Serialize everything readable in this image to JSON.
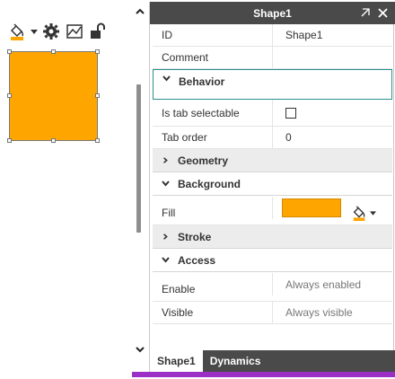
{
  "toolbar": {
    "icons": [
      "fill-bucket-icon",
      "gear-icon",
      "chart-icon",
      "unlock-icon"
    ],
    "colors": {
      "bucket_accent": "#ffa500"
    }
  },
  "shape": {
    "fill": "#ffa500"
  },
  "panel": {
    "title": "Shape1",
    "rows_top": [
      {
        "label": "ID",
        "value": "Shape1"
      },
      {
        "label": "Comment",
        "value": ""
      }
    ],
    "sections": {
      "behavior": "Behavior",
      "geometry": "Geometry",
      "background": "Background",
      "stroke": "Stroke",
      "access": "Access"
    },
    "behavior_rows": {
      "tab_selectable": {
        "label": "Is tab selectable",
        "checked": false
      },
      "tab_order": {
        "label": "Tab order",
        "value": "0"
      }
    },
    "background_rows": {
      "fill": {
        "label": "Fill",
        "color": "#ffa500"
      }
    },
    "access_rows": [
      {
        "label": "Enable",
        "value": "Always enabled"
      },
      {
        "label": "Visible",
        "value": "Always visible"
      }
    ],
    "tabs": [
      "Shape1",
      "Dynamics"
    ]
  }
}
